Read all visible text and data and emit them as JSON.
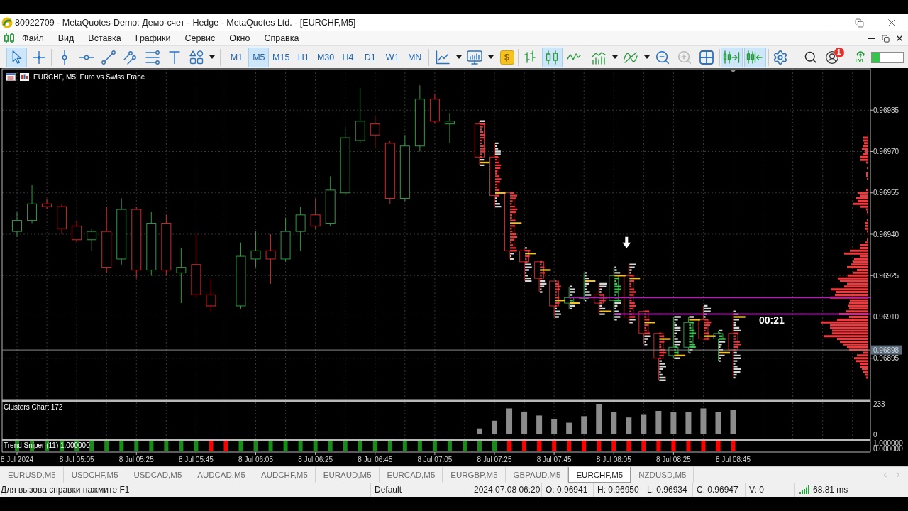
{
  "window": {
    "title": "80922709 - MetaQuotes-Demo: Демо-счет - Hedge - MetaQuotes Ltd. - [EURCHF,M5]"
  },
  "menu": [
    "Файл",
    "Вид",
    "Вставка",
    "Графики",
    "Сервис",
    "Окно",
    "Справка"
  ],
  "toolbar": {
    "drawing_tools": [
      {
        "selected": true
      },
      {
        "selected": false
      },
      {
        "selected": false
      },
      {
        "selected": false
      },
      {
        "selected": false
      },
      {
        "selected": false
      },
      {
        "selected": false
      },
      {
        "selected": false
      },
      {
        "selected": false
      }
    ],
    "timeframes": [
      {
        "label": "M1",
        "selected": false
      },
      {
        "label": "M5",
        "selected": true
      },
      {
        "label": "M15",
        "selected": false
      },
      {
        "label": "H1",
        "selected": false
      },
      {
        "label": "M30",
        "selected": false
      },
      {
        "label": "H4",
        "selected": false
      },
      {
        "label": "D1",
        "selected": false
      },
      {
        "label": "W1",
        "selected": false
      },
      {
        "label": "MN",
        "selected": false
      }
    ],
    "chart_tools": [
      {
        "selected": false
      },
      {
        "selected": false
      },
      {
        "selected": false,
        "glyph": "$"
      }
    ],
    "chart_types": [
      {
        "selected": false
      },
      {
        "selected": true
      },
      {
        "selected": false
      }
    ],
    "view_tools": [
      {
        "selected": false,
        "disabled": false
      },
      {
        "selected": false,
        "disabled": false
      },
      {
        "selected": false,
        "disabled": false
      },
      {
        "selected": false,
        "disabled": true
      },
      {
        "selected": false,
        "disabled": false
      }
    ],
    "scroll_tools": [
      {
        "selected": true
      },
      {
        "selected": true
      }
    ],
    "notifications": "1",
    "lvl_label": "LVL",
    "meter": {
      "level": 0.25
    }
  },
  "chart_window": {
    "chart_data": [
      {
        "type": "candlestick",
        "title": "EURCHF, M5: Euro vs Swiss Franc",
        "x": [
          "2024-07-08T04:45",
          "2024-07-08T04:50",
          "2024-07-08T04:55",
          "2024-07-08T05:00",
          "2024-07-08T05:05",
          "2024-07-08T05:10",
          "2024-07-08T05:15",
          "2024-07-08T05:20",
          "2024-07-08T05:25",
          "2024-07-08T05:30",
          "2024-07-08T05:35",
          "2024-07-08T05:40",
          "2024-07-08T05:45",
          "2024-07-08T05:50",
          "2024-07-08T06:00",
          "2024-07-08T06:05",
          "2024-07-08T06:10",
          "2024-07-08T06:15",
          "2024-07-08T06:20",
          "2024-07-08T06:25",
          "2024-07-08T06:30",
          "2024-07-08T06:35",
          "2024-07-08T06:40",
          "2024-07-08T06:45",
          "2024-07-08T06:50",
          "2024-07-08T06:55",
          "2024-07-08T07:00",
          "2024-07-08T07:05",
          "2024-07-08T07:10",
          "2024-07-08T07:20",
          "2024-07-08T07:25",
          "2024-07-08T07:30",
          "2024-07-08T07:35",
          "2024-07-08T07:40",
          "2024-07-08T07:45",
          "2024-07-08T07:50",
          "2024-07-08T07:55",
          "2024-07-08T08:00",
          "2024-07-08T08:05",
          "2024-07-08T08:10",
          "2024-07-08T08:15",
          "2024-07-08T08:20",
          "2024-07-08T08:25",
          "2024-07-08T08:30",
          "2024-07-08T08:35",
          "2024-07-08T08:40",
          "2024-07-08T08:45"
        ],
        "ohlc": [
          [
            0.96941,
            0.96948,
            0.96939,
            0.96945
          ],
          [
            0.96945,
            0.96958,
            0.96944,
            0.96951
          ],
          [
            0.96951,
            0.96953,
            0.96949,
            0.9695
          ],
          [
            0.9695,
            0.96951,
            0.9694,
            0.96942
          ],
          [
            0.96943,
            0.96945,
            0.96937,
            0.96938
          ],
          [
            0.96938,
            0.96942,
            0.96934,
            0.96941
          ],
          [
            0.96941,
            0.9695,
            0.96926,
            0.96928
          ],
          [
            0.96931,
            0.96953,
            0.96929,
            0.96949
          ],
          [
            0.96949,
            0.9695,
            0.96924,
            0.96927
          ],
          [
            0.96927,
            0.96948,
            0.96925,
            0.96944
          ],
          [
            0.96944,
            0.96947,
            0.96925,
            0.96927
          ],
          [
            0.96926,
            0.96935,
            0.96915,
            0.96928
          ],
          [
            0.96929,
            0.9694,
            0.96917,
            0.96918
          ],
          [
            0.96918,
            0.96924,
            0.96912,
            0.96914
          ],
          [
            0.96914,
            0.96937,
            0.96913,
            0.96932
          ],
          [
            0.96931,
            0.96941,
            0.96928,
            0.96934
          ],
          [
            0.96934,
            0.9694,
            0.96922,
            0.96931
          ],
          [
            0.96931,
            0.96946,
            0.9693,
            0.96941
          ],
          [
            0.96941,
            0.9695,
            0.96934,
            0.96947
          ],
          [
            0.96947,
            0.96953,
            0.96942,
            0.96943
          ],
          [
            0.96944,
            0.96961,
            0.96943,
            0.96956
          ],
          [
            0.96955,
            0.96979,
            0.96954,
            0.96975
          ],
          [
            0.96974,
            0.96993,
            0.96973,
            0.96981
          ],
          [
            0.9698,
            0.96983,
            0.96971,
            0.96976
          ],
          [
            0.96973,
            0.96974,
            0.96951,
            0.96953
          ],
          [
            0.96953,
            0.96976,
            0.96952,
            0.96972
          ],
          [
            0.96972,
            0.96994,
            0.9697,
            0.96989
          ],
          [
            0.96989,
            0.96991,
            0.9698,
            0.96981
          ],
          [
            0.9698,
            0.96984,
            0.96973,
            0.96981
          ],
          [
            0.9698,
            0.96981,
            0.96965,
            0.96968
          ],
          [
            0.96968,
            0.96973,
            0.9695,
            0.96954
          ],
          [
            0.96955,
            0.96955,
            0.96931,
            0.96934
          ],
          [
            0.96934,
            0.96935,
            0.96923,
            0.9693
          ],
          [
            0.9693,
            0.9693,
            0.96919,
            0.96924
          ],
          [
            0.96923,
            0.96923,
            0.9691,
            0.96914
          ],
          [
            0.96915,
            0.96921,
            0.96913,
            0.96917
          ],
          [
            0.96917,
            0.96926,
            0.96916,
            0.96917
          ],
          [
            0.96918,
            0.96922,
            0.96911,
            0.96915
          ],
          [
            0.96916,
            0.96928,
            0.96909,
            0.96925
          ],
          [
            0.96925,
            0.96929,
            0.96908,
            0.9691
          ],
          [
            0.96912,
            0.96912,
            0.969,
            0.96904
          ],
          [
            0.96904,
            0.96904,
            0.96887,
            0.96895
          ],
          [
            0.96896,
            0.9691,
            0.96895,
            0.96899
          ],
          [
            0.96899,
            0.9691,
            0.96897,
            0.96908
          ],
          [
            0.96909,
            0.96914,
            0.96902,
            0.96902
          ],
          [
            0.96902,
            0.96905,
            0.96894,
            0.96904
          ],
          [
            0.96904,
            0.96912,
            0.96888,
            0.96898
          ]
        ],
        "series": [
          {
            "type": "line",
            "color": "#b01eb4",
            "x": [
              "2024-07-08T07:50",
              "2024-07-08T09:31"
            ],
            "values": [
              0.96917,
              0.96917
            ]
          },
          {
            "type": "line",
            "color": "#b01eb4",
            "x": [
              "2024-07-08T08:05",
              "2024-07-08T09:31"
            ],
            "values": [
              0.96911,
              0.96911
            ]
          },
          {
            "type": "scatter",
            "color": "#ffffff",
            "x": [
              "2024-07-08T08:10"
            ],
            "values": [
              0.96937
            ]
          }
        ],
        "xlim": [
          "2024-07-08T04:40",
          "2024-07-08T09:31"
        ],
        "ylim": [
          0.9688,
          0.97
        ],
        "xticks": [
          "2024-07-08T04:45",
          "2024-07-08T05:05",
          "2024-07-08T05:25",
          "2024-07-08T05:45",
          "2024-07-08T06:05",
          "2024-07-08T06:25",
          "2024-07-08T06:45",
          "2024-07-08T07:05",
          "2024-07-08T07:25",
          "2024-07-08T07:45",
          "2024-07-08T08:05",
          "2024-07-08T08:25",
          "2024-07-08T08:45"
        ],
        "yticks": [
          {
            "value": 0.96985,
            "label": "0.96985"
          },
          {
            "value": 0.9697,
            "label": "0.96970"
          },
          {
            "value": 0.96955,
            "label": "0.96955"
          },
          {
            "value": 0.9694,
            "label": "0.96940"
          },
          {
            "value": 0.96925,
            "label": "0.96925"
          },
          {
            "value": 0.9691,
            "label": "0.96910"
          },
          {
            "value": 0.96895,
            "label": "0.96895"
          }
        ],
        "tick_labels": "y",
        "grid": true,
        "ref_lines": [
          {
            "axis": "y",
            "value": 0.96898,
            "label": "0.96898",
            "color": "#8a8a8a"
          }
        ],
        "annotations": [
          "00:21"
        ]
      },
      {
        "type": "bar",
        "title": "Clusters Chart 172",
        "x": [
          "2024-07-08T07:20",
          "2024-07-08T07:25",
          "2024-07-08T07:30",
          "2024-07-08T07:35",
          "2024-07-08T07:40",
          "2024-07-08T07:45",
          "2024-07-08T07:50",
          "2024-07-08T07:55",
          "2024-07-08T08:00",
          "2024-07-08T08:05",
          "2024-07-08T08:10",
          "2024-07-08T08:15",
          "2024-07-08T08:20",
          "2024-07-08T08:25",
          "2024-07-08T08:30",
          "2024-07-08T08:35",
          "2024-07-08T08:40",
          "2024-07-08T08:45"
        ],
        "values": [
          45,
          104,
          198,
          174,
          144,
          119,
          89,
          139,
          233,
          169,
          129,
          149,
          179,
          169,
          169,
          198,
          169,
          188
        ],
        "color": "#8c8c8c",
        "xlim": [
          "2024-07-08T04:40",
          "2024-07-08T09:31"
        ],
        "ylim": [
          0,
          233
        ],
        "yticks": [
          233,
          0
        ],
        "xticks": [
          "2024-07-08T04:45",
          "2024-07-08T05:05",
          "2024-07-08T05:25",
          "2024-07-08T05:45",
          "2024-07-08T06:05",
          "2024-07-08T06:25",
          "2024-07-08T06:45",
          "2024-07-08T07:05",
          "2024-07-08T07:25",
          "2024-07-08T07:45",
          "2024-07-08T08:05",
          "2024-07-08T08:25",
          "2024-07-08T08:45"
        ],
        "tick_labels": "y",
        "grid": true
      },
      {
        "type": "bar",
        "title": "Trend Sniper (11) 1.000000",
        "x": [
          "2024-07-08T04:45",
          "2024-07-08T04:50",
          "2024-07-08T04:55",
          "2024-07-08T05:00",
          "2024-07-08T05:05",
          "2024-07-08T05:10",
          "2024-07-08T05:15",
          "2024-07-08T05:20",
          "2024-07-08T05:25",
          "2024-07-08T05:30",
          "2024-07-08T05:35",
          "2024-07-08T05:40",
          "2024-07-08T05:45",
          "2024-07-08T05:50",
          "2024-07-08T05:55",
          "2024-07-08T06:00",
          "2024-07-08T06:05",
          "2024-07-08T06:10",
          "2024-07-08T06:15",
          "2024-07-08T06:20",
          "2024-07-08T06:25",
          "2024-07-08T06:30",
          "2024-07-08T06:35",
          "2024-07-08T06:40",
          "2024-07-08T06:45",
          "2024-07-08T06:50",
          "2024-07-08T06:55",
          "2024-07-08T07:00",
          "2024-07-08T07:05",
          "2024-07-08T07:10",
          "2024-07-08T07:15",
          "2024-07-08T07:20",
          "2024-07-08T07:25",
          "2024-07-08T07:30",
          "2024-07-08T07:35",
          "2024-07-08T07:40",
          "2024-07-08T07:45",
          "2024-07-08T07:50",
          "2024-07-08T07:55",
          "2024-07-08T08:00",
          "2024-07-08T08:05",
          "2024-07-08T08:10",
          "2024-07-08T08:15",
          "2024-07-08T08:20",
          "2024-07-08T08:25",
          "2024-07-08T08:30",
          "2024-07-08T08:35",
          "2024-07-08T08:40",
          "2024-07-08T08:45"
        ],
        "values": [
          1,
          1,
          1,
          1,
          1,
          1,
          1,
          1,
          1,
          1,
          1,
          1,
          1,
          1,
          1,
          1,
          1,
          1,
          1,
          1,
          1,
          1,
          1,
          1,
          1,
          1,
          1,
          1,
          1,
          1,
          1,
          1,
          1,
          1,
          1,
          1,
          1,
          1,
          1,
          1,
          1,
          1,
          1,
          1,
          1,
          1,
          1,
          1,
          1
        ],
        "colors": [
          "#1a8a1a",
          "#1a8a1a",
          "#1a8a1a",
          "#1a8a1a",
          "#1a8a1a",
          "#1a8a1a",
          "#1a8a1a",
          "#1a8a1a",
          "#1a8a1a",
          "#1a8a1a",
          "#1a8a1a",
          "#1a8a1a",
          "#1a8a1a",
          "#ff0000",
          "#ff0000",
          "#1a8a1a",
          "#1a8a1a",
          "#1a8a1a",
          "#1a8a1a",
          "#1a8a1a",
          "#1a8a1a",
          "#1a8a1a",
          "#1a8a1a",
          "#1a8a1a",
          "#1a8a1a",
          "#1a8a1a",
          "#1a8a1a",
          "#1a8a1a",
          "#1a8a1a",
          "#1a8a1a",
          "#1a8a1a",
          "#1a8a1a",
          "#1a8a1a",
          "#ff0000",
          "#ff0000",
          "#ff0000",
          "#ff0000",
          "#ff0000",
          "#ff0000",
          "#ff0000",
          "#ff0000",
          "#ff0000",
          "#ff0000",
          "#ff0000",
          "#ff0000",
          "#ff0000",
          "#ff0000",
          "#ff0000",
          "#ff0000"
        ],
        "xlim": [
          "2024-07-08T04:40",
          "2024-07-08T09:31"
        ],
        "ylim": [
          0,
          1
        ],
        "yticks": [
          {
            "value": 1,
            "label": "1.000000"
          },
          {
            "value": 0,
            "label": "0.000000"
          }
        ],
        "xticks": [
          {
            "value": "2024-07-08T04:45",
            "label": "8 Jul 2024"
          },
          {
            "value": "2024-07-08T05:05",
            "label": "8 Jul 05:05"
          },
          {
            "value": "2024-07-08T05:25",
            "label": "8 Jul 05:25"
          },
          {
            "value": "2024-07-08T05:45",
            "label": "8 Jul 05:45"
          },
          {
            "value": "2024-07-08T06:05",
            "label": "8 Jul 06:05"
          },
          {
            "value": "2024-07-08T06:25",
            "label": "8 Jul 06:25"
          },
          {
            "value": "2024-07-08T06:45",
            "label": "8 Jul 06:45"
          },
          {
            "value": "2024-07-08T07:05",
            "label": "8 Jul 07:05"
          },
          {
            "value": "2024-07-08T07:25",
            "label": "8 Jul 07:25"
          },
          {
            "value": "2024-07-08T07:45",
            "label": "8 Jul 07:45"
          },
          {
            "value": "2024-07-08T08:05",
            "label": "8 Jul 08:05"
          },
          {
            "value": "2024-07-08T08:25",
            "label": "8 Jul 08:25"
          },
          {
            "value": "2024-07-08T08:45",
            "label": "8 Jul 08:45"
          }
        ]
      }
    ]
  },
  "tabs": [
    {
      "label": "EURUSD,M5",
      "selected": false
    },
    {
      "label": "USDCHF,M5",
      "selected": false
    },
    {
      "label": "USDCAD,M5",
      "selected": false
    },
    {
      "label": "AUDCAD,M5",
      "selected": false
    },
    {
      "label": "AUDCHF,M5",
      "selected": false
    },
    {
      "label": "EURAUD,M5",
      "selected": false
    },
    {
      "label": "EURCAD,M5",
      "selected": false
    },
    {
      "label": "EURGBP,M5",
      "selected": false
    },
    {
      "label": "GBPAUD,M5",
      "selected": false
    },
    {
      "label": "EURCHF,M5",
      "selected": true
    },
    {
      "label": "NZDUSD,M5",
      "selected": false
    }
  ],
  "status_bar": {
    "help": "Для вызова справки нажмите F1",
    "profile": "Default",
    "time": "2024.07.08 06:20",
    "open": "O: 0.96941",
    "high": "H: 0.96950",
    "low": "L: 0.96934",
    "close": "C: 0.96947",
    "volume": "V: 0",
    "ping": "68.81 ms"
  }
}
